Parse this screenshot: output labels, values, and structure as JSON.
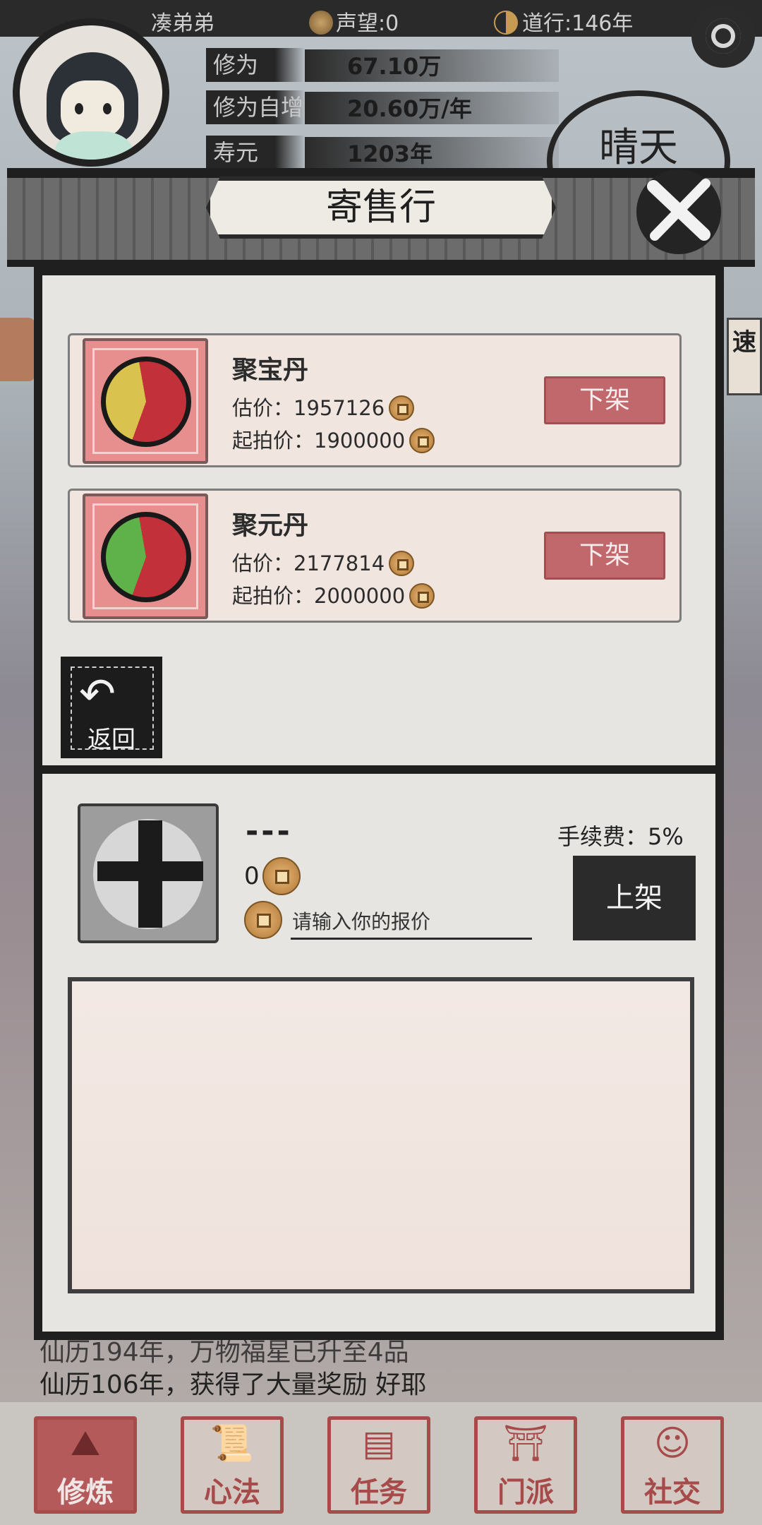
{
  "status_bar": {
    "player_name": "凑弟弟",
    "reputation": "声望:0",
    "daoxing": "道行:146年"
  },
  "stats": [
    {
      "label": "修为",
      "value": "67.10万"
    },
    {
      "label": "修为自增",
      "value": "20.60万/年"
    },
    {
      "label": "寿元",
      "value": "1203年"
    }
  ],
  "weather": "晴天",
  "side_right_label": "速",
  "modal": {
    "title": "寄售行",
    "listings": [
      {
        "name": "聚宝丹",
        "estimate": "估价：1957126",
        "start_price": "起拍价：1900000",
        "action": "下架",
        "pill_colors": [
          "#c2303a",
          "#d9c24e"
        ]
      },
      {
        "name": "聚元丹",
        "estimate": "估价：2177814",
        "start_price": "起拍价：2000000",
        "action": "下架",
        "pill_colors": [
          "#c2303a",
          "#5fb24a"
        ]
      }
    ],
    "back_label": "返回",
    "sell": {
      "item_name": "---",
      "price": "0",
      "offer_placeholder": "请输入你的报价",
      "fee": "手续费：5%",
      "list_button": "上架"
    }
  },
  "background_log": [
    "仙历194年，万物福星已升至4品",
    "仙历106年，获得了大量奖励 好耶"
  ],
  "bottom_nav": [
    {
      "label": "修炼",
      "icon": "mountain-icon",
      "active": true
    },
    {
      "label": "心法",
      "icon": "scroll-icon",
      "active": false
    },
    {
      "label": "任务",
      "icon": "task-scroll-icon",
      "active": false
    },
    {
      "label": "门派",
      "icon": "sect-gate-icon",
      "active": false
    },
    {
      "label": "社交",
      "icon": "people-icon",
      "active": false
    }
  ]
}
